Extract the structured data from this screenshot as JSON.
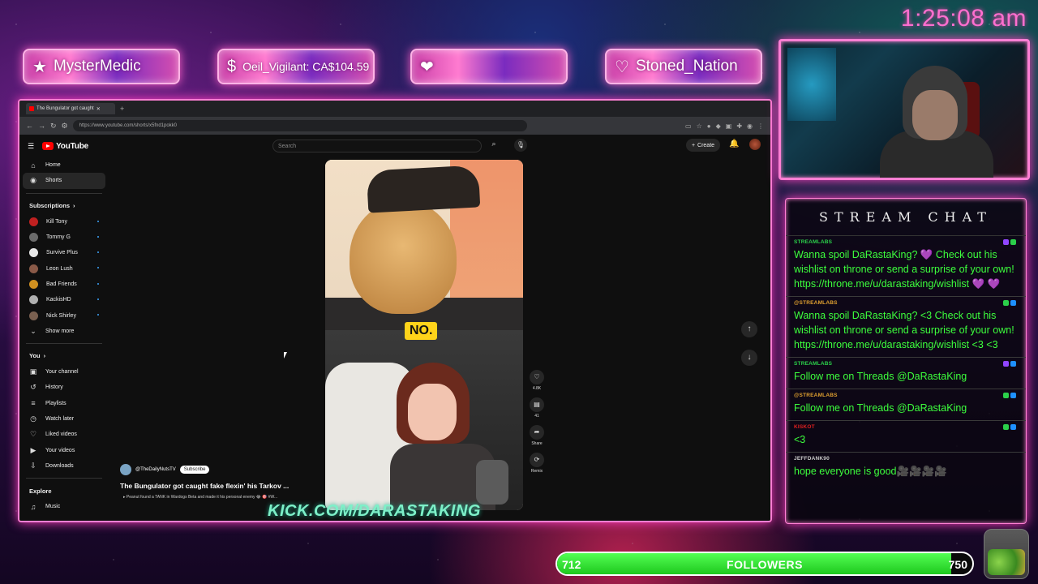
{
  "clock": "1:25:08 am",
  "badges": [
    {
      "icon": "★",
      "text": "MysterMedic"
    },
    {
      "icon": "$",
      "text": "Oeil_Vigilant: CA$104.59"
    },
    {
      "icon": "❤",
      "text": ""
    },
    {
      "icon": "♡",
      "text": "Stoned_Nation"
    }
  ],
  "browser": {
    "tab_title": "The Bungulator got caught",
    "url": "https://www.youtube.com/shorts/x5fnd1pokk0"
  },
  "youtube": {
    "logo": "YouTube",
    "search_placeholder": "Search",
    "create_label": "Create",
    "nav": [
      {
        "icon": "⌂",
        "label": "Home"
      },
      {
        "icon": "◉",
        "label": "Shorts"
      }
    ],
    "subscriptions_header": "Subscriptions",
    "subscriptions": [
      {
        "label": "Kill Tony",
        "color": "#c02020"
      },
      {
        "label": "Tommy G",
        "color": "#6b6b6b"
      },
      {
        "label": "Survive Plus",
        "color": "#e8e8e8"
      },
      {
        "label": "Leon Lush",
        "color": "#8a5a48"
      },
      {
        "label": "Bad Friends",
        "color": "#d09020"
      },
      {
        "label": "KackisHD",
        "color": "#b0b0b0"
      },
      {
        "label": "Nick Shirley",
        "color": "#7a6050"
      }
    ],
    "show_more": "Show more",
    "you_header": "You",
    "you_items": [
      {
        "icon": "▣",
        "label": "Your channel"
      },
      {
        "icon": "↺",
        "label": "History"
      },
      {
        "icon": "≡",
        "label": "Playlists"
      },
      {
        "icon": "◷",
        "label": "Watch later"
      },
      {
        "icon": "♡",
        "label": "Liked videos"
      },
      {
        "icon": "▶",
        "label": "Your videos"
      },
      {
        "icon": "⇩",
        "label": "Downloads"
      }
    ],
    "explore_header": "Explore",
    "explore_items": [
      {
        "icon": "♫",
        "label": "Music"
      }
    ],
    "short": {
      "overlay_text": "NO.",
      "channel": "@TheDailyNutsTV",
      "subscribe": "Subscribe",
      "title": "The Bungulator got caught fake flexin' his Tarkov ...",
      "description": "▸ Peanut found a TANK in Wardogs Beta and made it his personal enemy 😂 🎯 #W...",
      "likes": "4.8K",
      "comments": "41",
      "share_label": "Share",
      "remix_label": "Remix"
    }
  },
  "overlay_text": "KICK.COM/DARASTAKING",
  "chat": {
    "header": "STREAM CHAT",
    "messages": [
      {
        "user": "STREAMLABS",
        "user_color": "#2bd04a",
        "text": "Wanna spoil DaRastaKing? 💜 Check out his wishlist on throne or send a surprise of your own! https://throne.me/u/darastaking/wishlist 💜 💜"
      },
      {
        "user": "@STREAMLABS",
        "user_color": "#e0a030",
        "text": "Wanna spoil DaRastaKing? <3 Check out his wishlist on throne or send a surprise of your own! https://throne.me/u/darastaking/wishlist <3 <3"
      },
      {
        "user": "STREAMLABS",
        "user_color": "#2bd04a",
        "text": "Follow me on Threads @DaRastaKing"
      },
      {
        "user": "@STREAMLABS",
        "user_color": "#e0a030",
        "text": "Follow me on Threads @DaRastaKing"
      },
      {
        "user": "KISKOT",
        "user_color": "#e02020",
        "text": "<3"
      },
      {
        "user": "JEFFDANK90",
        "user_color": "#cccccc",
        "text": "hope everyone is good🎥🎥🎥🎥"
      }
    ]
  },
  "followers": {
    "current": "712",
    "label": "FOLLOWERS",
    "goal": "750",
    "progress": 0.949
  }
}
